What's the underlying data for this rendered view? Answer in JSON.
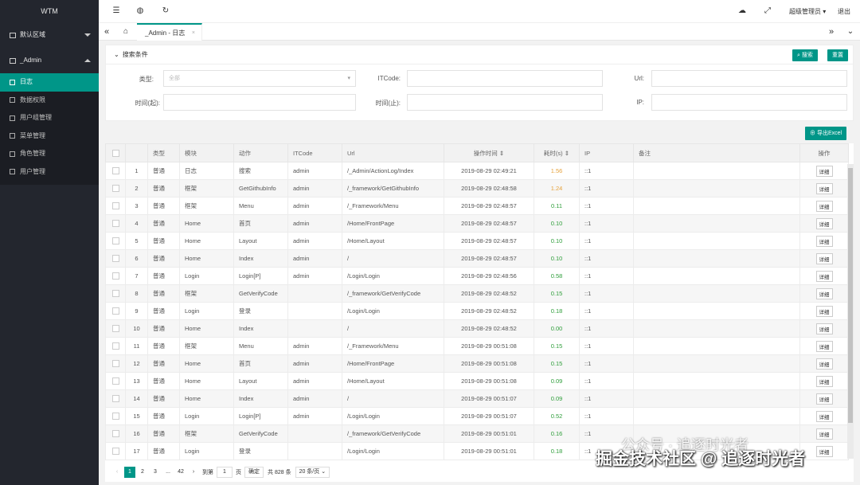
{
  "app": {
    "logo": "WTM"
  },
  "sidebar": {
    "groups": [
      {
        "label": "默认区域"
      },
      {
        "label": "_Admin"
      }
    ],
    "items": [
      {
        "label": "日志"
      },
      {
        "label": "数据权限"
      },
      {
        "label": "用户组管理"
      },
      {
        "label": "菜单管理"
      },
      {
        "label": "角色管理"
      },
      {
        "label": "用户管理"
      }
    ]
  },
  "topbar": {
    "user": "超级管理员",
    "logout": "退出"
  },
  "tabs": [
    {
      "label": "_Admin - 日志"
    }
  ],
  "search": {
    "title": "搜索条件",
    "search_btn": "搜索",
    "reset_btn": "重置",
    "labels": {
      "type": "类型:",
      "itcode": "ITCode:",
      "url": "Url:",
      "time_from": "时间(起):",
      "time_to": "时间(止):",
      "ip": "IP:"
    },
    "type_placeholder": "全部"
  },
  "export_btn": "导出Excel",
  "table": {
    "columns": [
      "类型",
      "模块",
      "动作",
      "ITCode",
      "Url",
      "操作时间",
      "耗时(s)",
      "IP",
      "备注",
      "操作"
    ],
    "detail": "详细",
    "rows": [
      [
        "1",
        "普通",
        "日志",
        "搜索",
        "admin",
        "/_Admin/ActionLog/Index",
        "2019-08-29 02:49:21",
        "1.56",
        "::1"
      ],
      [
        "2",
        "普通",
        "框架",
        "GetGithubInfo",
        "admin",
        "/_framework/GetGithubInfo",
        "2019-08-29 02:48:58",
        "1.24",
        "::1"
      ],
      [
        "3",
        "普通",
        "框架",
        "Menu",
        "admin",
        "/_Framework/Menu",
        "2019-08-29 02:48:57",
        "0.11",
        "::1"
      ],
      [
        "4",
        "普通",
        "Home",
        "首页",
        "admin",
        "/Home/FrontPage",
        "2019-08-29 02:48:57",
        "0.10",
        "::1"
      ],
      [
        "5",
        "普通",
        "Home",
        "Layout",
        "admin",
        "/Home/Layout",
        "2019-08-29 02:48:57",
        "0.10",
        "::1"
      ],
      [
        "6",
        "普通",
        "Home",
        "Index",
        "admin",
        "/",
        "2019-08-29 02:48:57",
        "0.10",
        "::1"
      ],
      [
        "7",
        "普通",
        "Login",
        "Login[P]",
        "admin",
        "/Login/Login",
        "2019-08-29 02:48:56",
        "0.58",
        "::1"
      ],
      [
        "8",
        "普通",
        "框架",
        "GetVerifyCode",
        "",
        "/_framework/GetVerifyCode",
        "2019-08-29 02:48:52",
        "0.15",
        "::1"
      ],
      [
        "9",
        "普通",
        "Login",
        "登录",
        "",
        "/Login/Login",
        "2019-08-29 02:48:52",
        "0.18",
        "::1"
      ],
      [
        "10",
        "普通",
        "Home",
        "Index",
        "",
        "/",
        "2019-08-29 02:48:52",
        "0.00",
        "::1"
      ],
      [
        "11",
        "普通",
        "框架",
        "Menu",
        "admin",
        "/_Framework/Menu",
        "2019-08-29 00:51:08",
        "0.15",
        "::1"
      ],
      [
        "12",
        "普通",
        "Home",
        "首页",
        "admin",
        "/Home/FrontPage",
        "2019-08-29 00:51:08",
        "0.15",
        "::1"
      ],
      [
        "13",
        "普通",
        "Home",
        "Layout",
        "admin",
        "/Home/Layout",
        "2019-08-29 00:51:08",
        "0.09",
        "::1"
      ],
      [
        "14",
        "普通",
        "Home",
        "Index",
        "admin",
        "/",
        "2019-08-29 00:51:07",
        "0.09",
        "::1"
      ],
      [
        "15",
        "普通",
        "Login",
        "Login[P]",
        "admin",
        "/Login/Login",
        "2019-08-29 00:51:07",
        "0.52",
        "::1"
      ],
      [
        "16",
        "普通",
        "框架",
        "GetVerifyCode",
        "",
        "/_framework/GetVerifyCode",
        "2019-08-29 00:51:01",
        "0.16",
        "::1"
      ],
      [
        "17",
        "普通",
        "Login",
        "登录",
        "",
        "/Login/Login",
        "2019-08-29 00:51:01",
        "0.18",
        "::1"
      ]
    ],
    "warn_colors": {
      "slow": "#e6a23c",
      "ok": "#2e9e3a"
    }
  },
  "pager": {
    "pages": [
      "1",
      "2",
      "3",
      "...",
      "42"
    ],
    "goto_label": "到第",
    "goto_value": "1",
    "page_unit": "页",
    "confirm": "确定",
    "total": "共 828 条",
    "page_size": "20 条/页"
  },
  "watermark": {
    "line1": "公众号 · 追逐时光者",
    "line2": "掘金技术社区 @ 追逐时光者"
  }
}
